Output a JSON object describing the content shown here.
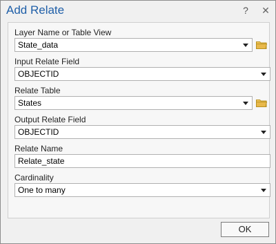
{
  "window": {
    "title": "Add Relate",
    "help_label": "?",
    "close_label": "✕"
  },
  "fields": [
    {
      "label": "Layer Name or Table View",
      "value": "State_data",
      "type": "combo",
      "browse_icon": "folder-icon"
    },
    {
      "label": "Input Relate Field",
      "value": "OBJECTID",
      "type": "combo"
    },
    {
      "label": "Relate Table",
      "value": "States",
      "type": "combo",
      "browse_icon": "folder-icon"
    },
    {
      "label": "Output Relate Field",
      "value": "OBJECTID",
      "type": "combo"
    },
    {
      "label": "Relate Name",
      "value": "Relate_state",
      "type": "text"
    },
    {
      "label": "Cardinality",
      "value": "One to many",
      "type": "combo"
    }
  ],
  "footer": {
    "ok_label": "OK"
  },
  "colors": {
    "title": "#1f5fa8",
    "folder": "#e8b84a"
  }
}
